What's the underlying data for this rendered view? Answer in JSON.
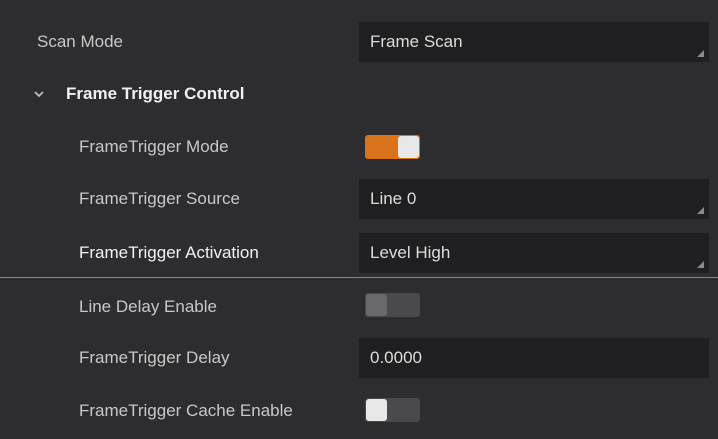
{
  "properties": {
    "scan_mode": {
      "label": "Scan Mode",
      "value": "Frame Scan"
    },
    "section": {
      "title": "Frame Trigger Control"
    },
    "frame_trigger_mode": {
      "label": "FrameTrigger Mode",
      "state": "on"
    },
    "frame_trigger_source": {
      "label": "FrameTrigger Source",
      "value": "Line 0"
    },
    "frame_trigger_activation": {
      "label": "FrameTrigger Activation",
      "value": "Level High"
    },
    "line_delay_enable": {
      "label": "Line Delay Enable",
      "state": "off"
    },
    "frame_trigger_delay": {
      "label": "FrameTrigger Delay",
      "value": "0.0000"
    },
    "frame_trigger_cache_enable": {
      "label": "FrameTrigger Cache Enable",
      "state": "off"
    }
  },
  "colors": {
    "panel_bg": "#2d2d30",
    "field_bg": "#1f1f21",
    "accent": "#d9731a"
  }
}
